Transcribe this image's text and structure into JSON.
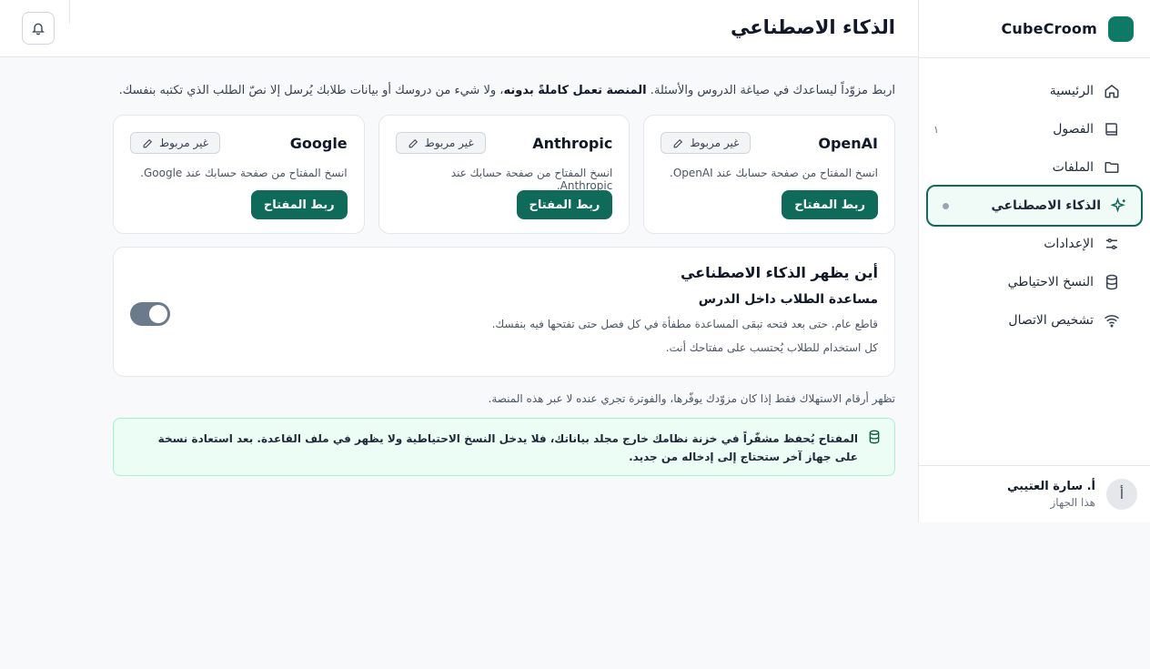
{
  "brand": {
    "name": "CubeCroom"
  },
  "header": {
    "title": "الذكاء الاصطناعي"
  },
  "sidebar": {
    "items": [
      {
        "label": "الرئيسية",
        "icon": "home-icon"
      },
      {
        "label": "الفصول",
        "icon": "book-icon",
        "badge": "١"
      },
      {
        "label": "الملفات",
        "icon": "folder-icon"
      },
      {
        "label": "الذكاء الاصطناعي",
        "icon": "sparkles-icon",
        "active": true
      },
      {
        "label": "الإعدادات",
        "icon": "sliders-icon"
      },
      {
        "label": "النسخ الاحتياطي",
        "icon": "database-icon"
      },
      {
        "label": "تشخيص الاتصال",
        "icon": "wifi-icon"
      }
    ],
    "user": {
      "avatar": "أ",
      "name": "أ. سارة العتيبي",
      "sub": "هذا الجهاز"
    }
  },
  "intro": {
    "part1": "اربط مزوّداً ليساعدك في صياغة الدروس والأسئلة. ",
    "bold": "المنصة تعمل كاملةً بدونه",
    "part2": "، ولا شيء من دروسك أو بيانات طلابك يُرسل إلا نصّ الطلب الذي تكتبه بنفسك."
  },
  "providers": [
    {
      "name": "OpenAI",
      "status": "غير مربوط",
      "desc": "انسخ المفتاح من صفحة حسابك عند OpenAI.",
      "button": "ربط المفتاح"
    },
    {
      "name": "Anthropic",
      "status": "غير مربوط",
      "desc": "انسخ المفتاح من صفحة حسابك عند Anthropic.",
      "button": "ربط المفتاح"
    },
    {
      "name": "Google",
      "status": "غير مربوط",
      "desc": "انسخ المفتاح من صفحة حسابك عند Google.",
      "button": "ربط المفتاح"
    }
  ],
  "where": {
    "title": "أين يظهر الذكاء الاصطناعي",
    "label": "مساعدة الطلاب داخل الدرس",
    "desc": "قاطع عام. حتى بعد فتحه تبقى المساعدة مطفأة في كل فصل حتى تفتحها فيه بنفسك.",
    "note": "كل استخدام للطلاب يُحتسب على مفتاحك أنت.",
    "toggle_on": true
  },
  "usage_note": "تظهر أرقام الاستهلاك فقط إذا كان مزوّدك يوفّرها، والفوترة تجري عنده لا عبر هذه المنصة.",
  "info": {
    "text": "المفتاح يُحفظ مشفّراً في خزنة نظامك خارج مجلد بياناتك، فلا يدخل النسخ الاحتياطية ولا يظهر في ملف القاعدة. بعد استعادة نسخة على جهاز آخر ستحتاج إلى إدخاله من جديد."
  },
  "colors": {
    "accent": "#0e6b5a",
    "info_bg": "#ecfdf5"
  }
}
